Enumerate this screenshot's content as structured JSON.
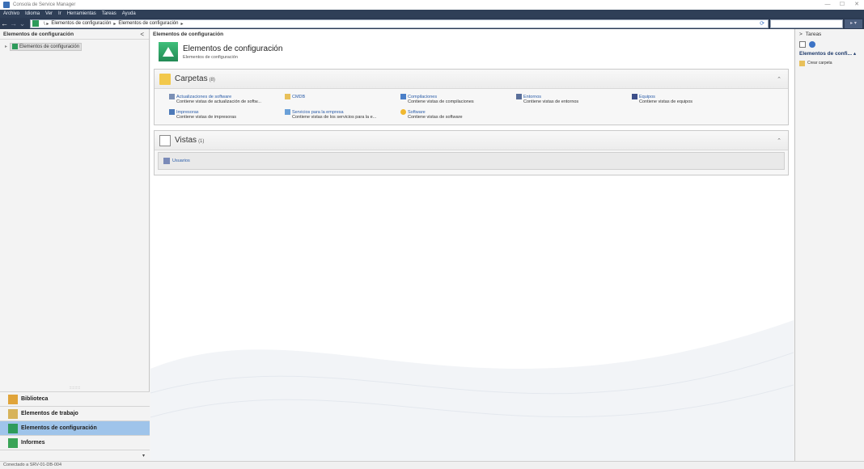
{
  "window": {
    "title": "Consola de Service Manager",
    "controls": [
      "—",
      "☐",
      "✕"
    ]
  },
  "menu": [
    "Archivo",
    "Idioma",
    "Ver",
    "Ir",
    "Herramientas",
    "Tareas",
    "Ayuda"
  ],
  "navigation": {
    "back": "←",
    "forward": "→",
    "history": "⌄",
    "breadcrumb": [
      "Elementos de configuración",
      "Elementos de configuración"
    ],
    "refresh": "⟳"
  },
  "left_pane": {
    "header": "Elementos de configuración",
    "collapse": "<",
    "tree": [
      {
        "label": "Elementos de configuración"
      }
    ]
  },
  "wunderbar": {
    "items": [
      {
        "label": "Biblioteca",
        "color": "#e0a43a",
        "active": false
      },
      {
        "label": "Elementos de trabajo",
        "color": "#d7b35a",
        "active": false
      },
      {
        "label": "Elementos de configuración",
        "color": "#2e9b5b",
        "active": true
      },
      {
        "label": "Informes",
        "color": "#3aa457",
        "active": false
      }
    ],
    "overflow": "▾"
  },
  "center": {
    "header": "Elementos de configuración",
    "hero_title": "Elementos de configuración",
    "hero_subtitle": "Elementos de configuración",
    "folders_group": {
      "title": "Carpetas",
      "count": "(8)",
      "items": [
        {
          "name": "Actualizaciones de software",
          "desc": "Contiene vistas de actualización de softw...",
          "icon": "#7a8fb5"
        },
        {
          "name": "CMDB",
          "desc": "",
          "icon": "#e8c05a"
        },
        {
          "name": "Compilaciones",
          "desc": "Contiene vistas de compilaciones",
          "icon": "#4a7fc8"
        },
        {
          "name": "Entornos",
          "desc": "Contiene vistas de entornos",
          "icon": "#5a6f9a"
        },
        {
          "name": "Equipos",
          "desc": "Contiene vistas de equipos",
          "icon": "#3d4f8a"
        },
        {
          "name": "Impresoras",
          "desc": "Contiene vistas de impresoras",
          "icon": "#4c79b8"
        },
        {
          "name": "Servicios para la empresa",
          "desc": "Contiene vistas de los servicios para la e...",
          "icon": "#6aa0d8"
        },
        {
          "name": "Software",
          "desc": "Contiene vistas de software",
          "icon": "#f0b830"
        }
      ]
    },
    "views_group": {
      "title": "Vistas",
      "count": "(1)",
      "items": [
        {
          "name": "Usuarios",
          "icon": "#7a8ab8"
        }
      ]
    },
    "caret": "⌃"
  },
  "right_pane": {
    "header": "Tareas",
    "header_arrow": ">",
    "section": "Elementos de confi...",
    "section_more": "▴",
    "tasks": [
      {
        "label": "Crear carpeta"
      }
    ]
  },
  "status": {
    "text": "Conectado a SRV-01-DB-004"
  }
}
